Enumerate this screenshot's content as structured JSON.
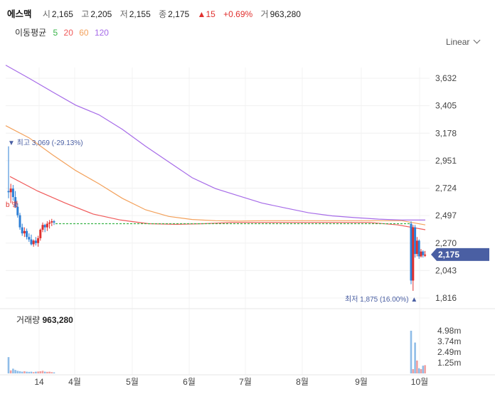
{
  "header": {
    "name": "에스맥",
    "open_label": "시",
    "open": "2,165",
    "high_label": "고",
    "high": "2,205",
    "low_label": "저",
    "low": "2,155",
    "close_label": "종",
    "close": "2,175",
    "change": "15",
    "change_pct": "+0.69%",
    "volume_label": "거",
    "volume": "963,280"
  },
  "ma_legend": {
    "title": "이동평균",
    "p5": "5",
    "p20": "20",
    "p60": "60",
    "p120": "120"
  },
  "scale_mode": "Linear",
  "colors": {
    "up": "#e0302e",
    "down": "#2d7fd6",
    "ma5": "#3ab54a",
    "ma20": "#f05a5a",
    "ma60": "#f3a15b",
    "ma120": "#a66be8",
    "price_tag": "#4a5fa3"
  },
  "annotations": {
    "high_label": "최고 3,069 (-29.13%)",
    "low_label": "최저 1,875 (16.00%)",
    "current_price": "2,175",
    "cut_text": "b 병"
  },
  "volume_panel": {
    "label": "거래량",
    "value": "963,280"
  },
  "chart_data": {
    "type": "candlestick",
    "y_ticks": [
      "3,632",
      "3,405",
      "3,178",
      "2,951",
      "2,724",
      "2,497",
      "2,270",
      "2,043",
      "1,816"
    ],
    "y_range": [
      1816,
      3632
    ],
    "x_ticks": [
      "14",
      "4월",
      "5월",
      "6월",
      "7월",
      "8월",
      "9월",
      "10월"
    ],
    "volume_ticks": [
      "4.98m",
      "3.74m",
      "2.49m",
      "1.25m"
    ],
    "candles_early": [
      {
        "o": 2700,
        "h": 3069,
        "l": 2640,
        "c": 2690
      },
      {
        "o": 2690,
        "h": 2760,
        "l": 2600,
        "c": 2720
      },
      {
        "o": 2720,
        "h": 2750,
        "l": 2620,
        "c": 2650
      },
      {
        "o": 2650,
        "h": 2700,
        "l": 2560,
        "c": 2570
      },
      {
        "o": 2570,
        "h": 2600,
        "l": 2480,
        "c": 2500
      },
      {
        "o": 2500,
        "h": 2520,
        "l": 2380,
        "c": 2400
      },
      {
        "o": 2400,
        "h": 2430,
        "l": 2330,
        "c": 2350
      },
      {
        "o": 2350,
        "h": 2400,
        "l": 2320,
        "c": 2370
      },
      {
        "o": 2370,
        "h": 2390,
        "l": 2300,
        "c": 2320
      },
      {
        "o": 2320,
        "h": 2350,
        "l": 2280,
        "c": 2300
      },
      {
        "o": 2300,
        "h": 2340,
        "l": 2250,
        "c": 2260
      },
      {
        "o": 2260,
        "h": 2300,
        "l": 2240,
        "c": 2290
      },
      {
        "o": 2290,
        "h": 2320,
        "l": 2250,
        "c": 2270
      },
      {
        "o": 2270,
        "h": 2330,
        "l": 2240,
        "c": 2310
      },
      {
        "o": 2310,
        "h": 2390,
        "l": 2290,
        "c": 2380
      },
      {
        "o": 2380,
        "h": 2440,
        "l": 2360,
        "c": 2420
      },
      {
        "o": 2420,
        "h": 2430,
        "l": 2360,
        "c": 2400
      },
      {
        "o": 2400,
        "h": 2450,
        "l": 2370,
        "c": 2430
      },
      {
        "o": 2430,
        "h": 2460,
        "l": 2390,
        "c": 2440
      },
      {
        "o": 2440,
        "h": 2470,
        "l": 2410,
        "c": 2450
      },
      {
        "o": 2450,
        "h": 2460,
        "l": 2420,
        "c": 2440
      }
    ],
    "halt_price": 2430,
    "candles_late": [
      {
        "o": 2430,
        "h": 2450,
        "l": 1930,
        "c": 1960
      },
      {
        "o": 1960,
        "h": 2420,
        "l": 1875,
        "c": 2400
      },
      {
        "o": 2400,
        "h": 2420,
        "l": 2150,
        "c": 2180
      },
      {
        "o": 2180,
        "h": 2320,
        "l": 2160,
        "c": 2290
      },
      {
        "o": 2290,
        "h": 2300,
        "l": 2140,
        "c": 2160
      },
      {
        "o": 2160,
        "h": 2220,
        "l": 2150,
        "c": 2200
      },
      {
        "o": 2200,
        "h": 2210,
        "l": 2150,
        "c": 2170
      },
      {
        "o": 2165,
        "h": 2205,
        "l": 2155,
        "c": 2175
      }
    ],
    "volume_early": [
      1.9,
      0.35,
      0.55,
      0.4,
      0.3,
      0.25,
      0.2,
      0.25,
      0.2,
      0.18,
      0.2,
      0.15,
      0.2,
      0.22,
      0.25,
      0.3,
      0.2,
      0.18,
      0.2,
      0.15,
      0.12
    ],
    "volume_late": [
      4.98,
      0.5,
      3.6,
      1.5,
      0.6,
      0.5,
      0.9,
      0.96
    ],
    "ma120": [
      3740,
      3632,
      3520,
      3410,
      3330,
      3210,
      3070,
      2940,
      2810,
      2720,
      2660,
      2600,
      2560,
      2520,
      2495,
      2480,
      2468,
      2460,
      2460
    ],
    "ma60": [
      3240,
      3140,
      3000,
      2870,
      2760,
      2640,
      2545,
      2490,
      2465,
      2455,
      2452,
      2455,
      2455,
      2455,
      2455,
      2455,
      2455,
      2455,
      2420
    ],
    "ma20": [
      2820,
      2700,
      2600,
      2510,
      2460,
      2430,
      2425,
      2430,
      2440,
      2440,
      2440,
      2440,
      2440,
      2440,
      2420,
      2380
    ]
  }
}
